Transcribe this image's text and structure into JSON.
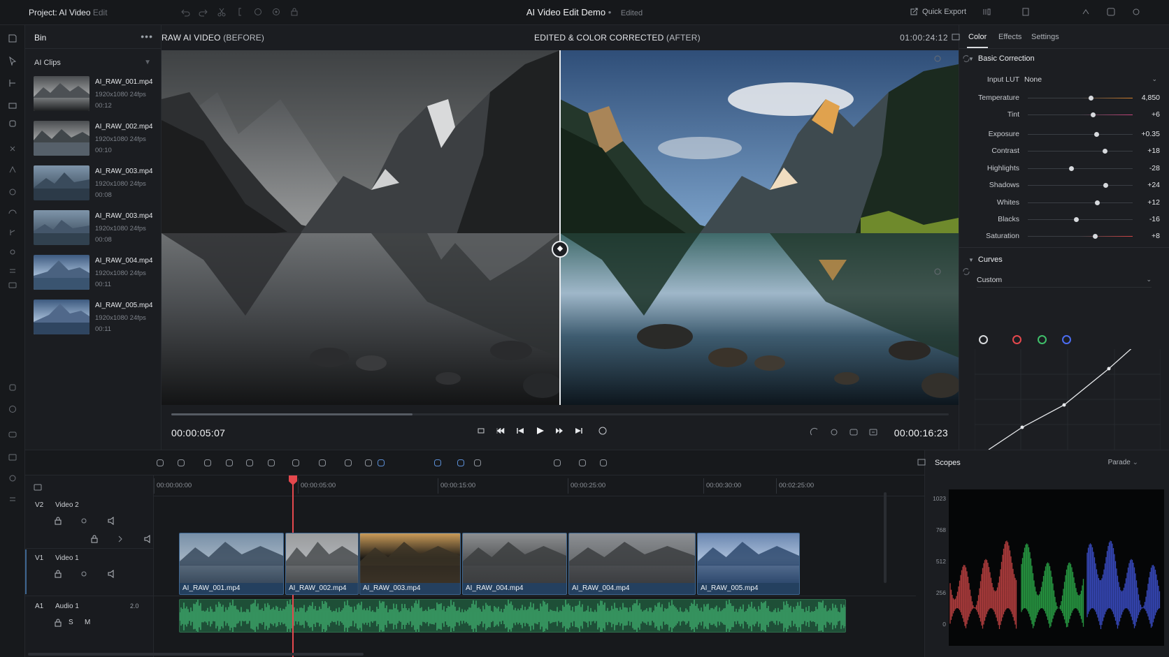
{
  "topbar": {
    "project_label": "Project: AI Video",
    "project_edit": "Edit",
    "title": "AI Video Edit Demo",
    "title_sep": "•",
    "status": "Edited",
    "quick_export": "Quick Export"
  },
  "bin": {
    "title": "Bin",
    "more": "•••",
    "folder": "AI Clips",
    "clips": [
      {
        "name": "AI_RAW_001.mp4",
        "res": "1920x1080 24fps",
        "dur": "00:12"
      },
      {
        "name": "AI_RAW_002.mp4",
        "res": "1920x1080 24fps",
        "dur": "00:10"
      },
      {
        "name": "AI_RAW_003.mp4",
        "res": "1920x1080 24fps",
        "dur": "00:08"
      },
      {
        "name": "AI_RAW_003.mp4",
        "res": "1920x1080 24fps",
        "dur": "00:08"
      },
      {
        "name": "AI_RAW_004.mp4",
        "res": "1920x1080 24fps",
        "dur": "00:11"
      },
      {
        "name": "AI_RAW_005.mp4",
        "res": "1920x1080 24fps",
        "dur": "00:11"
      }
    ]
  },
  "viewer": {
    "before_label": "RAW AI VIDEO",
    "before_tag": "(BEFORE)",
    "after_label": "EDITED & COLOR CORRECTED",
    "after_tag": "(AFTER)",
    "timecode_top": "01:00:24:12",
    "timecode_current": "00:00:05:07",
    "timecode_duration": "00:00:16:23",
    "progress": 0.31
  },
  "inspector": {
    "tabs": [
      "Color",
      "Effects",
      "Settings"
    ],
    "basic_title": "Basic Correction",
    "lut_label": "Input LUT",
    "lut_value": "None",
    "sliders": [
      {
        "label": "Temperature",
        "value": "4,850",
        "pos": 0.6
      },
      {
        "label": "Tint",
        "value": "+6",
        "pos": 0.62
      },
      {
        "label": "Exposure",
        "value": "+0.35",
        "pos": 0.65
      },
      {
        "label": "Contrast",
        "value": "+18",
        "pos": 0.73
      },
      {
        "label": "Highlights",
        "value": "-28",
        "pos": 0.41
      },
      {
        "label": "Shadows",
        "value": "+24",
        "pos": 0.74
      },
      {
        "label": "Whites",
        "value": "+12",
        "pos": 0.66
      },
      {
        "label": "Blacks",
        "value": "-16",
        "pos": 0.46
      },
      {
        "label": "Saturation",
        "value": "+8",
        "pos": 0.64
      }
    ],
    "curves_title": "Curves",
    "curves_preset": "Custom",
    "channels": [
      {
        "name": "luma",
        "color": "#d8dadd"
      },
      {
        "name": "red",
        "color": "#e5484d"
      },
      {
        "name": "green",
        "color": "#3fbf6a"
      },
      {
        "name": "blue",
        "color": "#4b6cf0"
      }
    ]
  },
  "timeline": {
    "ruler": [
      "00:00:00:00",
      "00:00:05:00",
      "00:00:15:00",
      "00:00:25:00",
      "00:00:30:00",
      "00:02:25:00"
    ],
    "tracks": {
      "v2": {
        "id": "V2",
        "name": "Video 2"
      },
      "v1": {
        "id": "V1",
        "name": "Video 1"
      },
      "a1": {
        "id": "A1",
        "name": "Audio 1",
        "level": "2.0",
        "s": "S",
        "m": "M"
      }
    },
    "clips": [
      "AI_RAW_001.mp4",
      "AI_RAW_002.mp4",
      "AI_RAW_003.mp4",
      "AI_RAW_004.mp4",
      "AI_RAW_004.mp4",
      "AI_RAW_005.mp4"
    ]
  },
  "scopes": {
    "title": "Scopes",
    "mode": "Parade",
    "y_labels": [
      "1023",
      "768",
      "512",
      "256",
      "0"
    ]
  },
  "colors": {
    "accent_red": "#e5484d",
    "accent_blue": "#3e6690",
    "audio_green": "#2f9a5c"
  }
}
